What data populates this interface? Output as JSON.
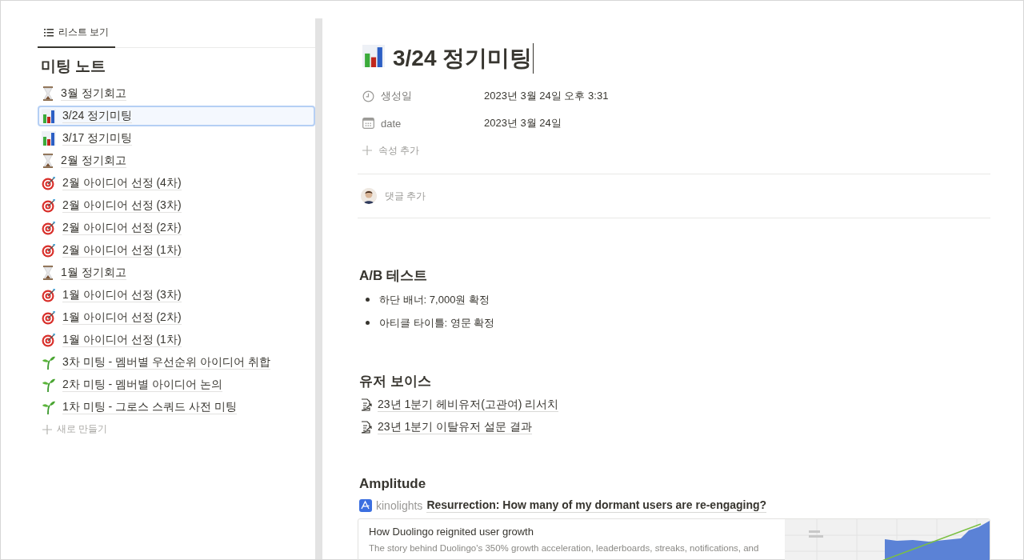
{
  "sidebar": {
    "view_tab": {
      "label": "리스트 보기",
      "selected": true
    },
    "title": "미팅 노트",
    "items": [
      {
        "kind": "hourglass",
        "label": "3월 정기회고",
        "selected": false
      },
      {
        "kind": "chart",
        "label": "3/24 정기미팅",
        "selected": true
      },
      {
        "kind": "chart",
        "label": "3/17 정기미팅",
        "selected": false
      },
      {
        "kind": "hourglass",
        "label": "2월 정기회고",
        "selected": false
      },
      {
        "kind": "target",
        "label": "2월 아이디어 선정 (4차)",
        "selected": false
      },
      {
        "kind": "target",
        "label": "2월 아이디어 선정 (3차)",
        "selected": false
      },
      {
        "kind": "target",
        "label": "2월 아이디어 선정 (2차)",
        "selected": false
      },
      {
        "kind": "target",
        "label": "2월 아이디어 선정 (1차)",
        "selected": false
      },
      {
        "kind": "hourglass",
        "label": "1월 정기회고",
        "selected": false
      },
      {
        "kind": "target",
        "label": "1월 아이디어 선정 (3차)",
        "selected": false
      },
      {
        "kind": "target",
        "label": "1월 아이디어 선정 (2차)",
        "selected": false
      },
      {
        "kind": "target",
        "label": "1월 아이디어 선정 (1차)",
        "selected": false
      },
      {
        "kind": "seedling",
        "label": "3차 미팅 - 멤버별 우선순위 아이디어 취합",
        "selected": false
      },
      {
        "kind": "seedling",
        "label": "2차 미팅 - 멤버별 아이디어 논의",
        "selected": false
      },
      {
        "kind": "seedling",
        "label": "1차 미팅 - 그로스 스쿼드 사전 미팅",
        "selected": false
      }
    ],
    "new_button": "새로 만들기"
  },
  "page": {
    "kind": "chart",
    "title": "3/24 정기미팅",
    "properties": [
      {
        "kind": "clock",
        "name": "생성일",
        "value": "2023년 3월 24일 오후 3:31"
      },
      {
        "kind": "calendar",
        "name": "date",
        "value": "2023년 3월 24일"
      }
    ],
    "add_property": "속성 추가",
    "add_comment": "댓글 추가",
    "sections": [
      {
        "heading": "A/B 테스트",
        "bullets": [
          "하단 배너: 7,000원 확정",
          "아티클 타이틀: 영문 확정"
        ]
      },
      {
        "heading": "유저 보이스",
        "links": [
          "23년 1분기 헤비유저(고관여) 리서치",
          "23년 1분기 이탈유저 설문 결과"
        ]
      },
      {
        "heading": "Amplitude",
        "mention": {
          "workspace": "kinolights",
          "title": "Resurrection: How many of my dormant users are re-engaging?"
        },
        "bookmark": {
          "title": "How Duolingo reignited user growth",
          "description": "The story behind Duolingo's 350% growth acceleration, leaderboards, streaks, notifications, and"
        }
      }
    ]
  }
}
